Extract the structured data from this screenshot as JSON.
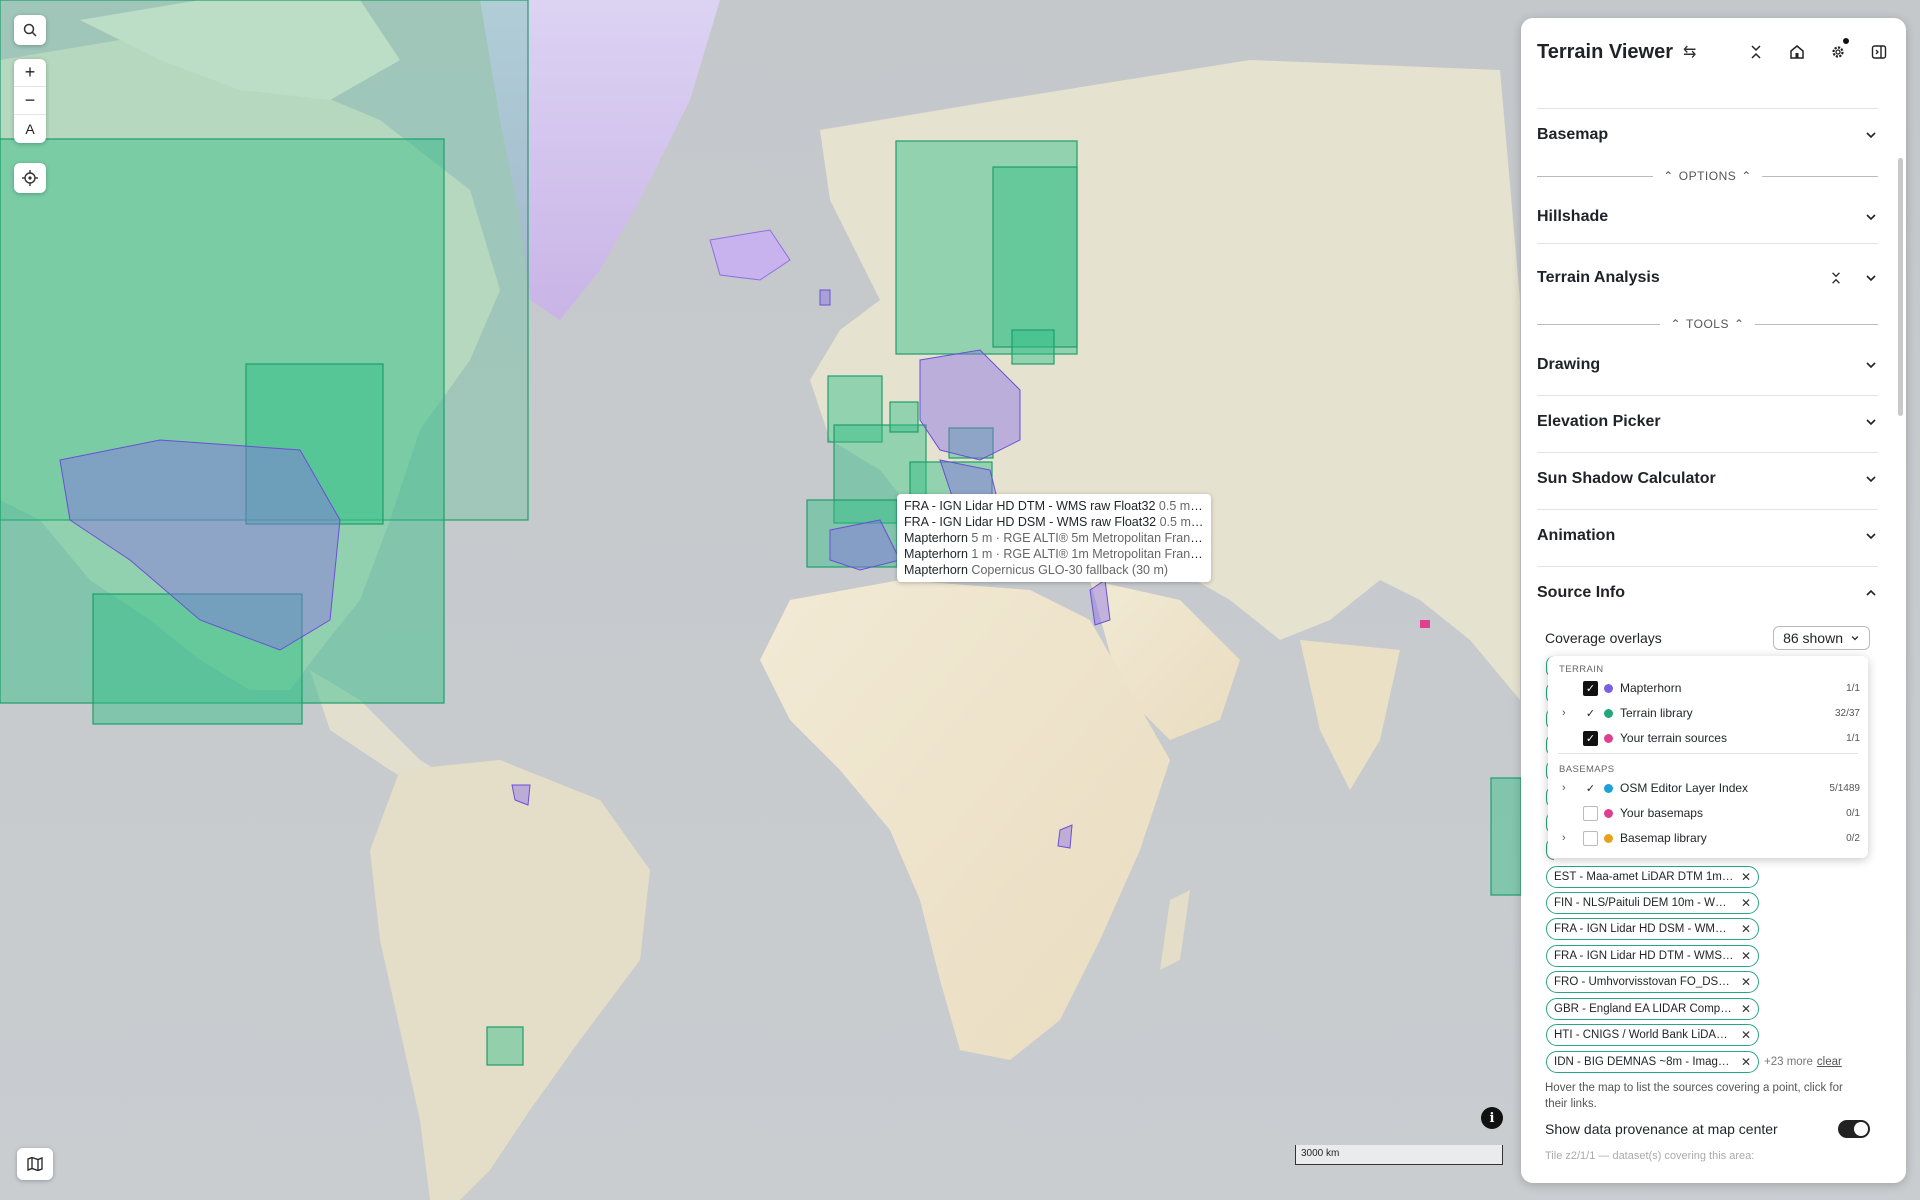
{
  "map": {
    "controls": {
      "search": "search",
      "zoom_in": "+",
      "zoom_out": "−",
      "compass": "A",
      "locate": "locate",
      "layers": "layers"
    },
    "tooltip": {
      "rows": [
        {
          "name": "FRA - IGN Lidar HD DTM - WMS raw Float32",
          "detail": "0.5 m · ..."
        },
        {
          "name": "FRA - IGN Lidar HD DSM - WMS raw Float32",
          "detail": "0.5 m · ..."
        },
        {
          "name": "Mapterhorn",
          "detail": "5 m · RGE ALTI® 5m Metropolitan France..."
        },
        {
          "name": "Mapterhorn",
          "detail": "1 m · RGE ALTI® 1m Metropolitan France..."
        },
        {
          "name": "Mapterhorn",
          "detail": "Copernicus GLO-30 fallback (30 m)"
        }
      ]
    },
    "scale_label": "3000 km",
    "info_label": "i"
  },
  "panel": {
    "title": "Terrain Viewer",
    "sections": {
      "basemap": "Basemap",
      "options": "OPTIONS",
      "hillshade": "Hillshade",
      "terrain_analysis": "Terrain Analysis",
      "tools": "TOOLS",
      "drawing": "Drawing",
      "elevation_picker": "Elevation Picker",
      "sun_shadow": "Sun Shadow Calculator",
      "animation": "Animation",
      "source_info": "Source Info"
    },
    "coverage": {
      "label": "Coverage overlays",
      "shown": "86 shown"
    },
    "dropdown": {
      "terrain_group": "TERRAIN",
      "basemaps_group": "BASEMAPS",
      "items": [
        {
          "name": "Mapterhorn",
          "count": "1/1",
          "color": "#7b5fe0"
        },
        {
          "name": "Terrain library",
          "count": "32/37",
          "color": "#22a67a"
        },
        {
          "name": "Your terrain sources",
          "count": "1/1",
          "color": "#de3f8e"
        },
        {
          "name": "OSM Editor Layer Index",
          "count": "5/1489",
          "color": "#1ea0d8"
        },
        {
          "name": "Your basemaps",
          "count": "0/1",
          "color": "#de3f8e"
        },
        {
          "name": "Basemap library",
          "count": "0/2",
          "color": "#e6a21a"
        }
      ]
    },
    "chips": [
      "EST - Maa-amet LiDAR DTM 1m - ...",
      "FIN - NLS/Paituli DEM 10m - WCS r...",
      "FRA - IGN Lidar HD DSM - WMS ra...",
      "FRA - IGN Lidar HD DTM - WMS ra...",
      "FRO - Umhvorvisstovan FO_DSM_2...",
      "GBR - England EA LIDAR Composit...",
      "HTI - CNIGS / World Bank LiDAR D...",
      "IDN - BIG DEMNAS ~8m - ImageSe..."
    ],
    "more_text": "+23 more",
    "clear_text": "clear",
    "hint": "Hover the map to list the sources covering a point, click for their links.",
    "provenance_label": "Show data provenance at map center",
    "provenance_on": true,
    "tile_info": "Tile z2/1/1 — dataset(s) covering this area:"
  }
}
